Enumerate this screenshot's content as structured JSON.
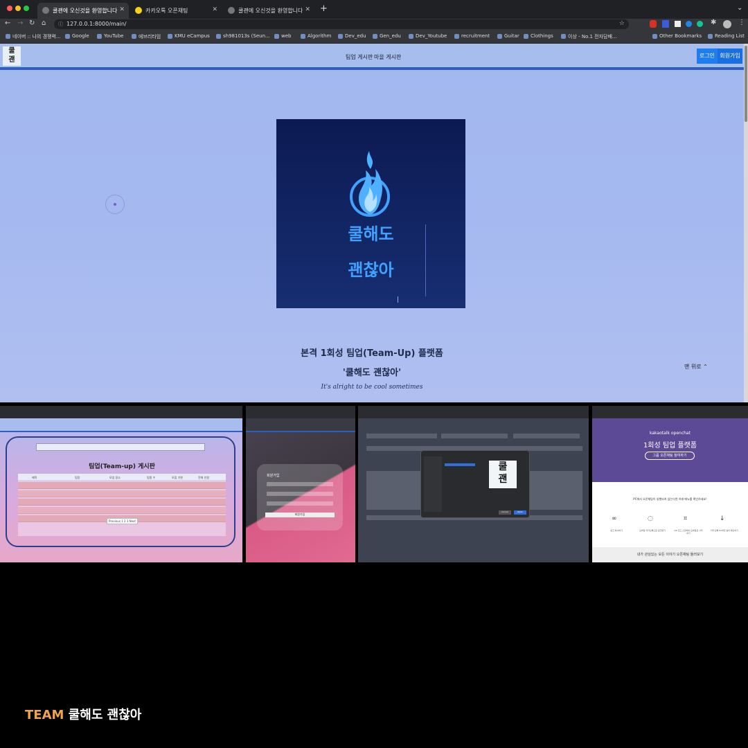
{
  "browser": {
    "tabs": [
      {
        "title": "쿨괜에 오신것을 환영합니다",
        "active": true
      },
      {
        "title": "카카오톡 오픈채팅",
        "active": false
      },
      {
        "title": "쿨괜에 오신것을 환영합니다",
        "active": false
      }
    ],
    "new_tab": "+",
    "url": "127.0.0.1:8000/main/",
    "bookmarks": [
      "네이버 :: 나의 경쟁력...",
      "Google",
      "YouTube",
      "에브리타임",
      "KMU eCampus",
      "sh981013s (Seun...",
      "web",
      "Algorithm",
      "Dev_edu",
      "Gen_edu",
      "Dev_Youtube",
      "recruitment",
      "Guitar",
      "Clothings",
      "이상 - No.1 전자담배...",
      "Other Bookmarks",
      "Reading List"
    ]
  },
  "site": {
    "logo": [
      "쿨",
      "괜"
    ],
    "nav": [
      "팀업 게시판",
      "마을 게시판"
    ],
    "login": "로그인",
    "signup": "회원가입",
    "hero": {
      "line1": "쿨해도",
      "line2": "괜찮아"
    },
    "headline": "본격 1회성 팀업(Team-Up) 플랫폼",
    "quote": "'쿨해도 괜찮아'",
    "subtitle": "It's alright to be cool sometimes",
    "top_link": "맨 위로"
  },
  "thumb1": {
    "board_title": "팀업(Team-up) 게시판",
    "columns": [
      "제목",
      "팀장",
      "모임 장소",
      "팀원 수",
      "모집 기한",
      "전체 인원"
    ],
    "pager": [
      "Previous",
      "1",
      "2",
      "3",
      "Next"
    ]
  },
  "thumb2": {
    "form_title": "회원가입",
    "submit": "회원가입"
  },
  "thumb3": {
    "logo": [
      "쿨",
      "괜"
    ],
    "cancel": "Cancel",
    "open": "Open"
  },
  "thumb4": {
    "brand": "kakaotalk openchat",
    "heading": "1회성 팀업 플랫폼",
    "join": "그룹 오픈채팅 참여하기",
    "notice": "PC에서 오픈채팅이 실행되지 않는다면 아래 메뉴를 확인하세요!",
    "actions": [
      "링크 복사하기",
      "모바일 카카오톡으로 링크받기",
      "QR 코드 스캔해서 모바일로 시작하기",
      "카카오톡 PC버전 설치 확인하기"
    ],
    "footer": "내가 관심있는 모든 이야기 오픈채팅 둘러보기"
  },
  "caption": {
    "team": "TEAM",
    "name": "쿨해도 괜찮아"
  },
  "colors": {
    "accent_blue": "#1e7ef0",
    "caption_orange": "#f0a44b",
    "hero_text": "#3fa2ff"
  }
}
